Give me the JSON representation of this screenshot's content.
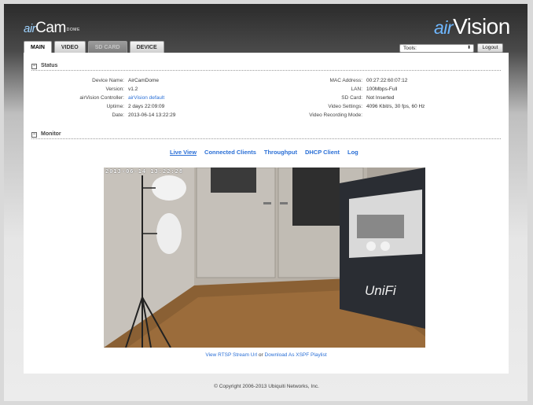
{
  "header": {
    "logo_left_air": "air",
    "logo_left_cam": "Cam",
    "logo_left_dome": "DOME",
    "logo_right_air": "air",
    "logo_right_vision": "Vision"
  },
  "tabs": [
    {
      "label": "MAIN"
    },
    {
      "label": "VIDEO"
    },
    {
      "label": "SD CARD"
    },
    {
      "label": "DEVICE"
    }
  ],
  "toolbar": {
    "tools_selected": "Tools:",
    "logout_label": "Logout"
  },
  "status": {
    "title": "Status",
    "left": [
      {
        "key": "Device Name:",
        "value": "AirCamDome"
      },
      {
        "key": "Version:",
        "value": "v1.2"
      },
      {
        "key": "airVision Controller:",
        "value": "airVision default"
      },
      {
        "key": "Uptime:",
        "value": "2 days 22:09:09"
      },
      {
        "key": "Date:",
        "value": "2013-06-14 13:22:29"
      }
    ],
    "right": [
      {
        "key": "MAC Address:",
        "value": "00:27:22:60:07:12"
      },
      {
        "key": "LAN:",
        "value": "100Mbps-Full"
      },
      {
        "key": "SD Card:",
        "value": "Not Inserted"
      },
      {
        "key": "Video Settings:",
        "value": "4096 Kbit/s, 30 fps, 60 Hz"
      },
      {
        "key": "Video Recording Mode:",
        "value": ""
      }
    ]
  },
  "monitor": {
    "title": "Monitor",
    "links": [
      "Live View",
      "Connected Clients",
      "Throughput",
      "DHCP Client",
      "Log"
    ],
    "timestamp": "2013-06-14 13:22:28",
    "banner_text": "UniFi",
    "stream_link": "View RTSP Stream Url",
    "or_text": "or",
    "playlist_link": "Download As XSPF Playlist"
  },
  "footer": {
    "copyright": "© Copyright 2006-2013 Ubiquiti Networks, Inc."
  }
}
